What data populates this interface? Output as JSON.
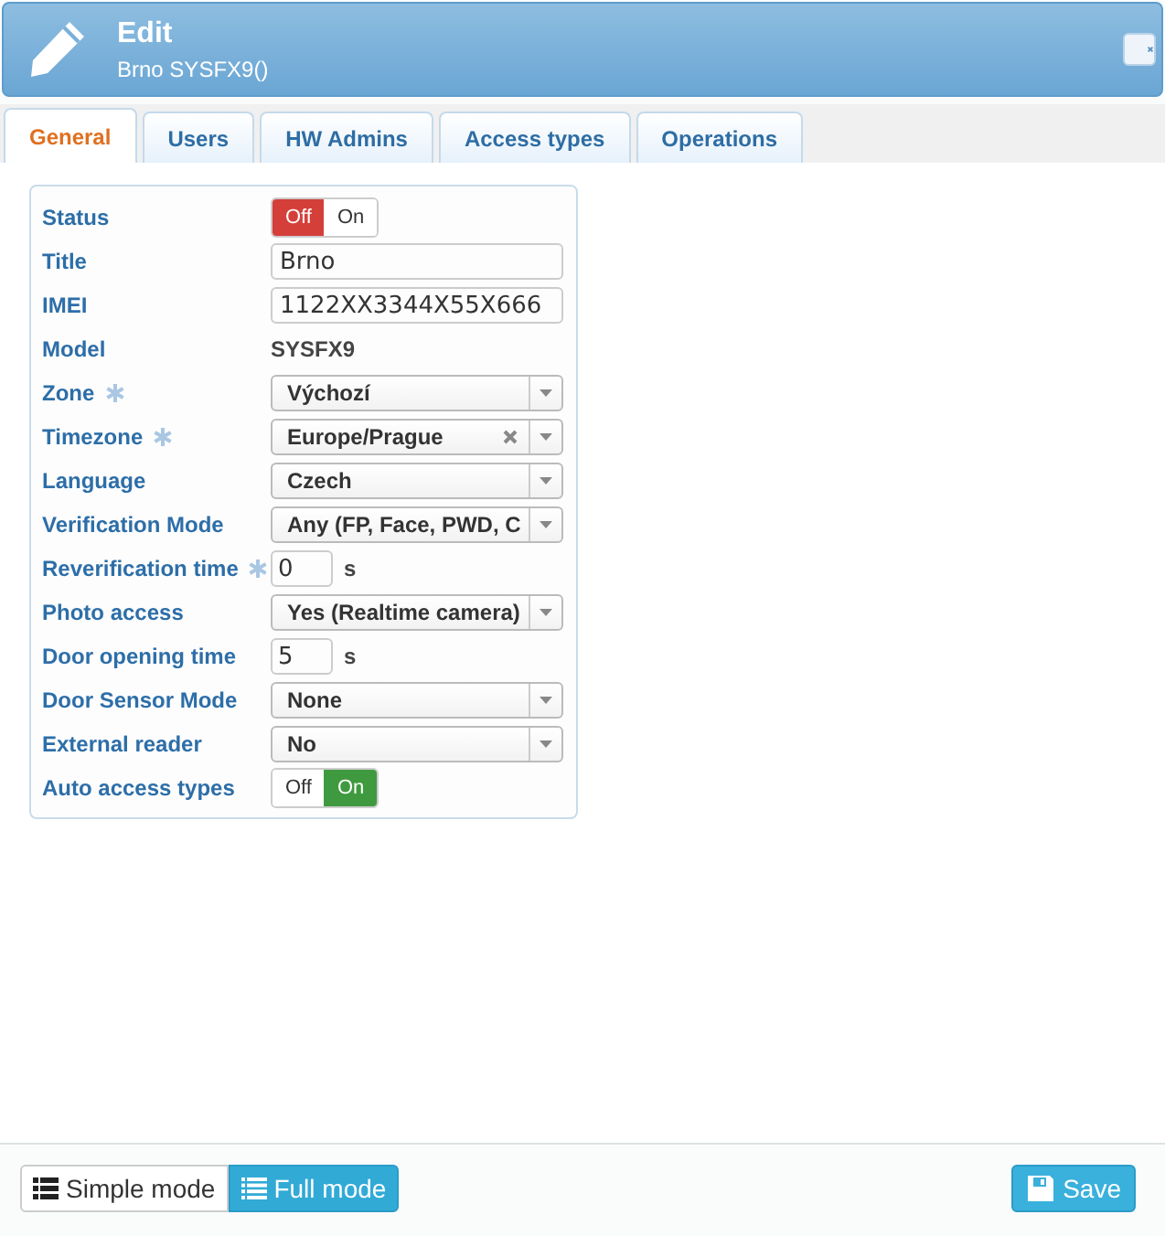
{
  "header": {
    "title": "Edit",
    "subtitle": "Brno SYSFX9()"
  },
  "tabs": [
    {
      "label": "General",
      "selected": true
    },
    {
      "label": "Users",
      "selected": false
    },
    {
      "label": "HW Admins",
      "selected": false
    },
    {
      "label": "Access types",
      "selected": false
    },
    {
      "label": "Operations",
      "selected": false
    }
  ],
  "fields": [
    {
      "kind": "toggle",
      "label": "Status",
      "off_label": "Off",
      "on_label": "On",
      "on": false
    },
    {
      "kind": "text",
      "label": "Title",
      "value": "Brno"
    },
    {
      "kind": "text",
      "label": "IMEI",
      "value": "1122XX3344X55X666"
    },
    {
      "kind": "static",
      "label": "Model",
      "value": "SYSFX9"
    },
    {
      "kind": "select",
      "label": "Zone",
      "required": true,
      "value": "Výchozí"
    },
    {
      "kind": "select",
      "label": "Timezone",
      "required": true,
      "value": "Europe/Prague",
      "clearable": true
    },
    {
      "kind": "select",
      "label": "Language",
      "value": "Czech"
    },
    {
      "kind": "select",
      "label": "Verification Mode",
      "value": "Any (FP, Face, PWD, C"
    },
    {
      "kind": "number",
      "label": "Reverification time",
      "required": true,
      "value": "0",
      "unit": "s"
    },
    {
      "kind": "select",
      "label": "Photo access",
      "value": "Yes (Realtime camera)"
    },
    {
      "kind": "number",
      "label": "Door opening time",
      "value": "5",
      "unit": "s"
    },
    {
      "kind": "select",
      "label": "Door Sensor Mode",
      "value": "None"
    },
    {
      "kind": "select",
      "label": "External reader",
      "value": "No"
    },
    {
      "kind": "toggle",
      "label": "Auto access types",
      "off_label": "Off",
      "on_label": "On",
      "on": true
    }
  ],
  "footer": {
    "modes": [
      {
        "label": "Simple mode",
        "selected": false
      },
      {
        "label": "Full mode",
        "selected": true
      }
    ],
    "save": "Save"
  }
}
